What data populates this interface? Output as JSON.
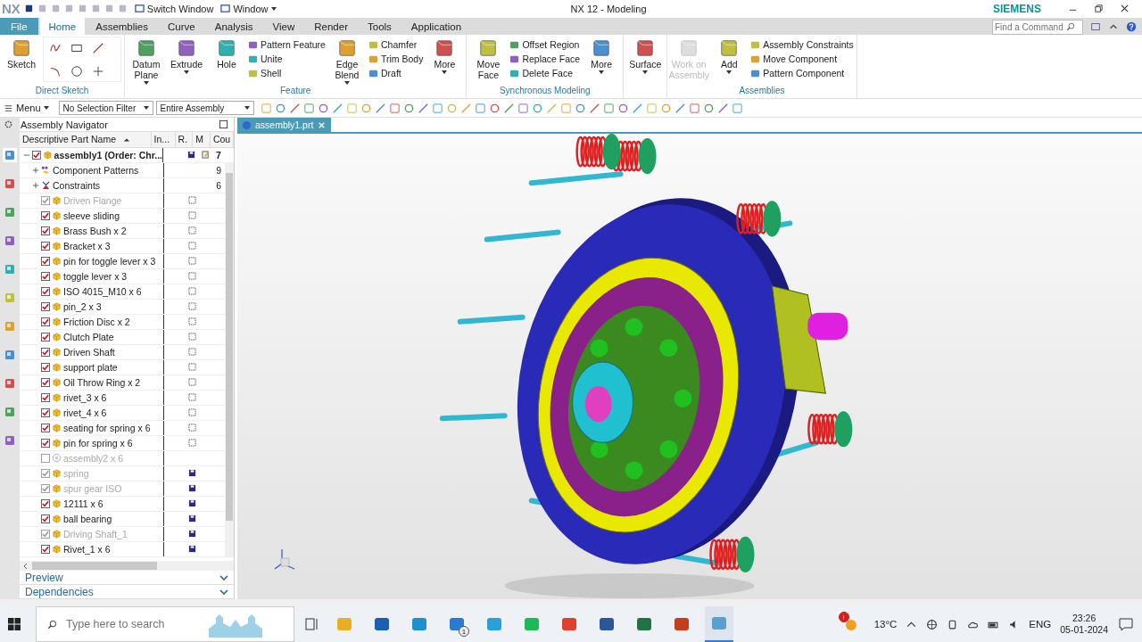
{
  "titlebar": {
    "logo": "NX",
    "quick_access": [
      {
        "label": "Switch Window"
      },
      {
        "label": "Window",
        "dropdown": true
      }
    ],
    "title": "NX 12 - Modeling",
    "brand": "SIEMENS"
  },
  "ribbon_tabs": [
    {
      "label": "File",
      "selected": false,
      "kind": "file"
    },
    {
      "label": "Home",
      "selected": true,
      "kind": "tab"
    },
    {
      "label": "Assemblies",
      "selected": false,
      "kind": "tab"
    },
    {
      "label": "Curve",
      "selected": false,
      "kind": "tab"
    },
    {
      "label": "Analysis",
      "selected": false,
      "kind": "tab"
    },
    {
      "label": "View",
      "selected": false,
      "kind": "tab"
    },
    {
      "label": "Render",
      "selected": false,
      "kind": "tab"
    },
    {
      "label": "Tools",
      "selected": false,
      "kind": "tab"
    },
    {
      "label": "Application",
      "selected": false,
      "kind": "tab"
    }
  ],
  "command_search": {
    "placeholder": "Find a Command"
  },
  "ribbon_groups": [
    {
      "label": "Direct Sketch",
      "items": [
        {
          "kind": "large",
          "label": "Sketch",
          "dropdown": false,
          "disabled": false
        },
        {
          "kind": "grid"
        }
      ]
    },
    {
      "label": "Feature",
      "items": [
        {
          "kind": "large",
          "label": "Datum Plane",
          "dropdown": true,
          "disabled": false
        },
        {
          "kind": "large",
          "label": "Extrude",
          "dropdown": true,
          "disabled": false
        },
        {
          "kind": "large",
          "label": "Hole",
          "dropdown": false,
          "disabled": false
        },
        {
          "kind": "stack",
          "labels": [
            "Pattern Feature",
            "Unite",
            "Shell"
          ]
        },
        {
          "kind": "large",
          "label": "Edge Blend",
          "dropdown": true,
          "disabled": false
        },
        {
          "kind": "stack",
          "labels": [
            "Chamfer",
            "Trim Body",
            "Draft"
          ]
        },
        {
          "kind": "large",
          "label": "More",
          "dropdown": true,
          "disabled": false
        }
      ]
    },
    {
      "label": "Synchronous Modeling",
      "items": [
        {
          "kind": "large",
          "label": "Move Face",
          "dropdown": false,
          "disabled": false
        },
        {
          "kind": "stack",
          "labels": [
            "Offset Region",
            "Replace Face",
            "Delete Face"
          ]
        },
        {
          "kind": "large",
          "label": "More",
          "dropdown": true,
          "disabled": false
        }
      ]
    },
    {
      "items": [
        {
          "kind": "large",
          "label": "Surface",
          "dropdown": true,
          "disabled": false
        }
      ]
    },
    {
      "label": "Assemblies",
      "items": [
        {
          "kind": "large",
          "label": "Work on Assembly",
          "dropdown": false,
          "disabled": true
        },
        {
          "kind": "large",
          "label": "Add",
          "dropdown": true,
          "disabled": false
        },
        {
          "kind": "stack",
          "labels": [
            "Assembly Constraints",
            "Move Component",
            "Pattern Component"
          ]
        }
      ]
    }
  ],
  "toolbar": {
    "menu": "Menu",
    "selection_filter": "No Selection Filter",
    "scope": "Entire Assembly"
  },
  "navigator": {
    "title": "Assembly Navigator",
    "columns": [
      "Descriptive Part Name",
      "In...",
      "R.",
      "M",
      "Cou"
    ],
    "tree": {
      "name": "assembly1 (Order: Chr...",
      "kind": "assembly",
      "checked": true,
      "dimmed": false,
      "expanded": true,
      "saved": true,
      "modified": true,
      "count": "7",
      "children": [
        {
          "name": "Component Patterns",
          "kind": "pattern",
          "expanded": false,
          "count": "9"
        },
        {
          "name": "Constraints",
          "kind": "constraints",
          "expanded": false,
          "count": "6"
        },
        {
          "name": "Driven Flange",
          "kind": "part",
          "checked": true,
          "dimmed": true,
          "saved": false
        },
        {
          "name": "sleeve sliding",
          "kind": "part",
          "checked": true,
          "dimmed": false,
          "saved": false
        },
        {
          "name": "Brass Bush x 2",
          "kind": "part",
          "checked": true,
          "dimmed": false,
          "saved": false
        },
        {
          "name": "Bracket x 3",
          "kind": "part",
          "checked": true,
          "dimmed": false,
          "saved": false
        },
        {
          "name": "pin for toggle lever x 3",
          "kind": "part",
          "checked": true,
          "dimmed": false,
          "saved": false
        },
        {
          "name": "toggle lever x 3",
          "kind": "part",
          "checked": true,
          "dimmed": false,
          "saved": false
        },
        {
          "name": "ISO 4015_M10 x 6",
          "kind": "part",
          "checked": true,
          "dimmed": false,
          "saved": false
        },
        {
          "name": "pin_2 x 3",
          "kind": "part",
          "checked": true,
          "dimmed": false,
          "saved": false
        },
        {
          "name": "Friction Disc x 2",
          "kind": "part",
          "checked": true,
          "dimmed": false,
          "saved": false
        },
        {
          "name": "Clutch Plate",
          "kind": "part",
          "checked": true,
          "dimmed": false,
          "saved": false
        },
        {
          "name": "Driven Shaft",
          "kind": "part",
          "checked": true,
          "dimmed": false,
          "saved": false
        },
        {
          "name": "support plate",
          "kind": "part",
          "checked": true,
          "dimmed": false,
          "saved": false
        },
        {
          "name": "Oil Throw Ring x 2",
          "kind": "part",
          "checked": true,
          "dimmed": false,
          "saved": false
        },
        {
          "name": "rivet_3 x 6",
          "kind": "part",
          "checked": true,
          "dimmed": false,
          "saved": false
        },
        {
          "name": "rivet_4 x 6",
          "kind": "part",
          "checked": true,
          "dimmed": false,
          "saved": false
        },
        {
          "name": "seating for spring x 6",
          "kind": "part",
          "checked": true,
          "dimmed": false,
          "saved": false
        },
        {
          "name": "pin for spring x 6",
          "kind": "part",
          "checked": true,
          "dimmed": false,
          "saved": false
        },
        {
          "name": "assembly2 x 6",
          "kind": "subassembly",
          "checked": false,
          "dimmed": true
        },
        {
          "name": "spring",
          "kind": "part",
          "checked": true,
          "dimmed": true,
          "saved": true
        },
        {
          "name": "spur gear ISO",
          "kind": "part",
          "checked": true,
          "dimmed": true,
          "saved": true
        },
        {
          "name": "12111 x 6",
          "kind": "part",
          "checked": true,
          "dimmed": false,
          "saved": true
        },
        {
          "name": "ball bearing",
          "kind": "part",
          "checked": true,
          "dimmed": false,
          "saved": true
        },
        {
          "name": "Driving Shaft_1",
          "kind": "part",
          "checked": true,
          "dimmed": true,
          "saved": true
        },
        {
          "name": "Rivet_1 x 6",
          "kind": "part",
          "checked": true,
          "dimmed": false,
          "saved": true
        }
      ]
    },
    "sections": [
      {
        "label": "Preview",
        "expanded": false
      },
      {
        "label": "Dependencies",
        "expanded": false
      }
    ]
  },
  "document_tab": {
    "label": "assembly1.prt",
    "selected": true
  },
  "taskbar": {
    "search_placeholder": "Type here to search",
    "mail_badge": "1",
    "weather_badge": "!",
    "temperature": "13°C",
    "language": "ENG",
    "time": "23:26",
    "date": "05-01-2024"
  }
}
